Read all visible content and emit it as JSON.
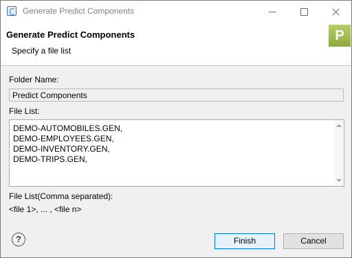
{
  "window": {
    "title": "Generate Predict Components"
  },
  "header": {
    "title": "Generate Predict Components",
    "subtitle": "Specify a file list",
    "logo_letter": "P"
  },
  "form": {
    "folder_label": "Folder Name:",
    "folder_value": "Predict Components",
    "file_list_label": "File List:",
    "file_list": [
      "DEMO-AUTOMOBILES.GEN,",
      "DEMO-EMPLOYEES.GEN,",
      "DEMO-INVENTORY.GEN,",
      "DEMO-TRIPS.GEN,"
    ],
    "hint_label": "File List(Comma separated):",
    "hint_value": "<file 1>, ... , <file n>"
  },
  "buttons": {
    "finish": "Finish",
    "cancel": "Cancel",
    "help": "?"
  },
  "colors": {
    "logo": "#9bb84a",
    "finish_border": "#0078d7"
  }
}
